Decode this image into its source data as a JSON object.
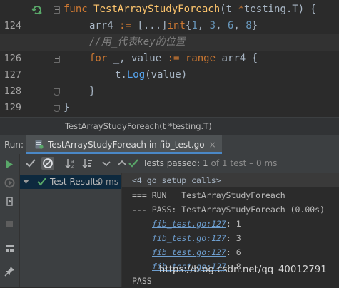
{
  "editor": {
    "lines": [
      {
        "num": "124"
      },
      {
        "num": "125"
      },
      {
        "num": "126"
      },
      {
        "num": "127"
      },
      {
        "num": "128"
      },
      {
        "num": "129"
      },
      {
        "num": "130"
      }
    ],
    "code": {
      "l124_kw": "func",
      "l124_name": "TestArrayStudyForeach",
      "l124_paren": "(t ",
      "l124_star": "*",
      "l124_type": "testing.T",
      "l124_close": ") {",
      "l125_a": "arr4 ",
      "l125_op": ":=",
      "l125_b": " [...]",
      "l125_int": "int",
      "l125_c": "{",
      "l125_n1": "1",
      "l125_n2": "3",
      "l125_n3": "6",
      "l125_n4": "8",
      "l125_end": "}",
      "l126_comment": "//用_代表key的位置",
      "l127_for": "for",
      "l127_a": " _, value ",
      "l127_op": ":=",
      "l127_range": "range",
      "l127_b": " arr4 {",
      "l128_t": "t.",
      "l128_call": "Log",
      "l128_args": "(value)",
      "l129": "}",
      "l130": "}"
    },
    "breadcrumb": "TestArrayStudyForeach(t *testing.T)"
  },
  "run_panel": {
    "run_label": "Run:",
    "tab_label": "TestArrayStudyForeach in fib_test.go",
    "tab_close": "×",
    "status": "Tests passed: ",
    "status_count": "1",
    "status_rest": " of 1 test – 0 ms"
  },
  "tree": {
    "root_label": "Test Results",
    "root_duration": "0 ms"
  },
  "console": {
    "setup": "<4 go setup calls>",
    "run_line": "=== RUN   TestArrayStudyForeach",
    "pass_line": "--- PASS: TestArrayStudyForeach (0.00s)",
    "log_entries": [
      {
        "link": "fib_test.go:127",
        "value": ": 1"
      },
      {
        "link": "fib_test.go:127",
        "value": ": 3"
      },
      {
        "link": "fib_test.go:127",
        "value": ": 6"
      },
      {
        "link": "fib_test.go:127",
        "value": ": 8"
      }
    ],
    "final": "PASS"
  },
  "watermark": "https://blog.csdn.net/qq_40012791",
  "colors": {
    "background": "#2b2b2b",
    "keyword": "#cc7832",
    "function": "#ffc66d",
    "number": "#6897bb",
    "comment": "#808080",
    "pass_green": "#59a869",
    "link": "#6d9ecf"
  }
}
